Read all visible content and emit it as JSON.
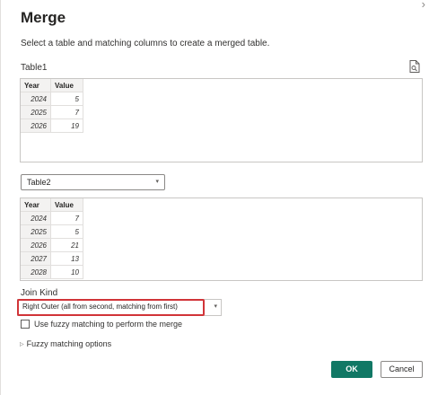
{
  "dialog": {
    "title": "Merge",
    "subtitle": "Select a table and matching columns to create a merged table.",
    "close_glyph": "›"
  },
  "table1": {
    "label": "Table1",
    "columns": [
      "Year",
      "Value"
    ],
    "rows": [
      [
        "2024",
        "5"
      ],
      [
        "2025",
        "7"
      ],
      [
        "2026",
        "19"
      ]
    ]
  },
  "table2": {
    "selected": "Table2",
    "columns": [
      "Year",
      "Value"
    ],
    "rows": [
      [
        "2024",
        "7"
      ],
      [
        "2025",
        "5"
      ],
      [
        "2026",
        "21"
      ],
      [
        "2027",
        "13"
      ],
      [
        "2028",
        "10"
      ]
    ]
  },
  "join": {
    "label": "Join Kind",
    "selected": "Right Outer (all from second, matching from first)"
  },
  "fuzzy": {
    "checkbox_label": "Use fuzzy matching to perform the merge",
    "checked": false,
    "options_label": "Fuzzy matching options"
  },
  "buttons": {
    "ok": "OK",
    "cancel": "Cancel"
  },
  "colors": {
    "accent": "#117865",
    "highlight": "#d13438"
  }
}
